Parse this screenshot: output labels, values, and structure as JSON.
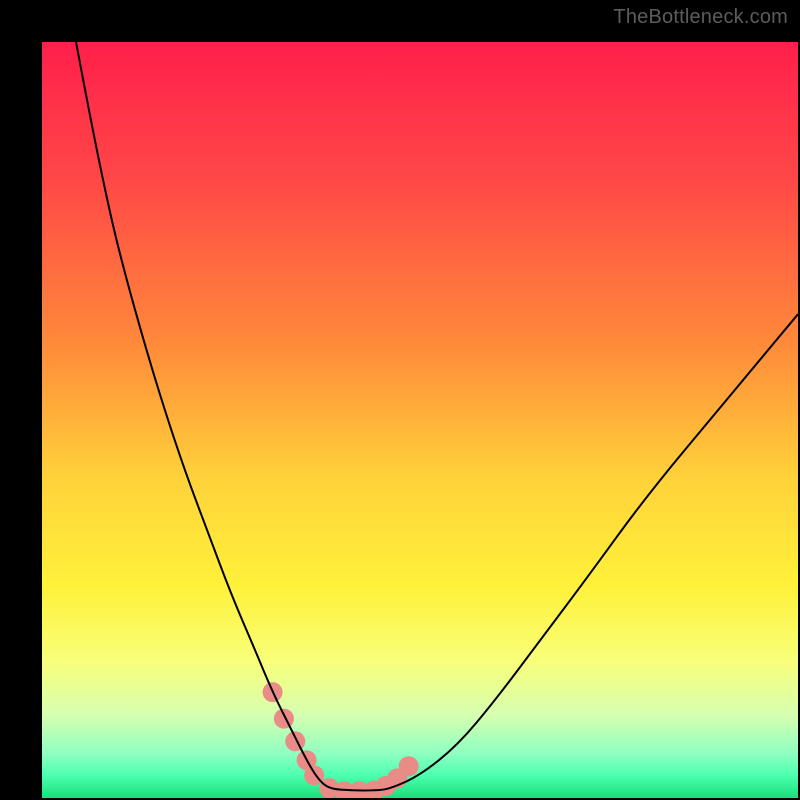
{
  "watermark": "TheBottleneck.com",
  "chart_data": {
    "type": "line",
    "title": "",
    "xlabel": "",
    "ylabel": "",
    "legend": false,
    "grid": false,
    "xlim": [
      0,
      100
    ],
    "ylim": [
      0,
      100
    ],
    "background_gradient_stops": [
      {
        "offset": 0.0,
        "color": "#ff1f4b"
      },
      {
        "offset": 0.18,
        "color": "#ff4747"
      },
      {
        "offset": 0.4,
        "color": "#ff8a3a"
      },
      {
        "offset": 0.58,
        "color": "#ffd33a"
      },
      {
        "offset": 0.72,
        "color": "#fff13a"
      },
      {
        "offset": 0.82,
        "color": "#f8ff7a"
      },
      {
        "offset": 0.89,
        "color": "#d6ffb0"
      },
      {
        "offset": 0.94,
        "color": "#90ffc0"
      },
      {
        "offset": 0.97,
        "color": "#4dffb0"
      },
      {
        "offset": 1.0,
        "color": "#18e07a"
      }
    ],
    "series": [
      {
        "name": "bottleneck-curve",
        "stroke": "#000000",
        "stroke_width": 2,
        "x": [
          4.5,
          6,
          8,
          10,
          13,
          16,
          19,
          22,
          25,
          28,
          30.5,
          33,
          35,
          36.5,
          38,
          41,
          44,
          46,
          50,
          55,
          60,
          66,
          72,
          80,
          90,
          100
        ],
        "values": [
          100,
          92,
          82,
          73,
          62,
          52,
          43,
          35,
          27,
          20,
          14,
          9,
          5,
          2.5,
          1.2,
          1.0,
          1.0,
          1.2,
          3,
          7,
          13,
          21,
          29,
          40,
          52,
          64
        ]
      }
    ],
    "markers": {
      "name": "highlight-dots",
      "color": "#e98b86",
      "radius_px": 10,
      "x": [
        30.5,
        32,
        33.5,
        35,
        36,
        38,
        40,
        42,
        44,
        45.5,
        47,
        48.5
      ],
      "values": [
        14,
        10.5,
        7.5,
        5,
        3,
        1.3,
        0.9,
        0.9,
        1.0,
        1.6,
        2.6,
        4.2
      ]
    }
  }
}
